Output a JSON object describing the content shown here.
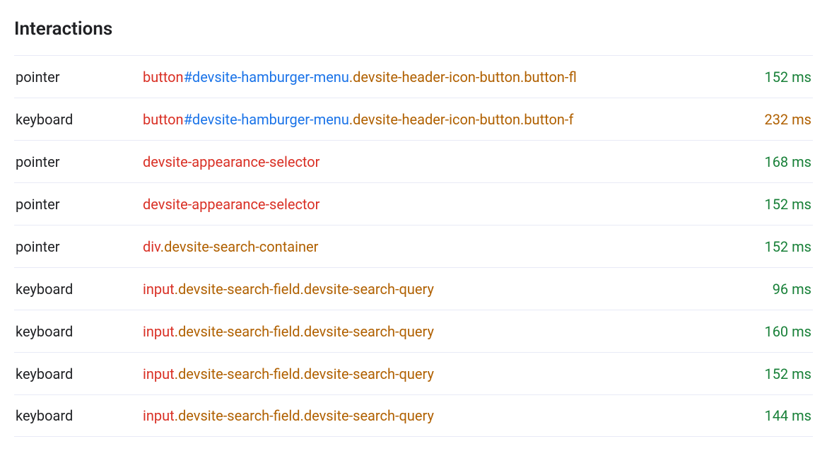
{
  "title": "Interactions",
  "colors": {
    "element": "#d93025",
    "id": "#1a73e8",
    "class": "#b06000",
    "timeGood": "#188038",
    "timeWarn": "#b06000"
  },
  "rows": [
    {
      "type": "pointer",
      "target": [
        {
          "kind": "el",
          "text": "button"
        },
        {
          "kind": "id",
          "text": "#devsite-hamburger-menu"
        },
        {
          "kind": "cls",
          "text": ".devsite-header-icon-button.button-fl"
        }
      ],
      "time": "152 ms",
      "timeLevel": "good"
    },
    {
      "type": "keyboard",
      "target": [
        {
          "kind": "el",
          "text": "button"
        },
        {
          "kind": "id",
          "text": "#devsite-hamburger-menu"
        },
        {
          "kind": "cls",
          "text": ".devsite-header-icon-button.button-f"
        }
      ],
      "time": "232 ms",
      "timeLevel": "warn"
    },
    {
      "type": "pointer",
      "target": [
        {
          "kind": "el",
          "text": "devsite-appearance-selector"
        }
      ],
      "time": "168 ms",
      "timeLevel": "good"
    },
    {
      "type": "pointer",
      "target": [
        {
          "kind": "el",
          "text": "devsite-appearance-selector"
        }
      ],
      "time": "152 ms",
      "timeLevel": "good"
    },
    {
      "type": "pointer",
      "target": [
        {
          "kind": "el",
          "text": "div"
        },
        {
          "kind": "cls",
          "text": ".devsite-search-container"
        }
      ],
      "time": "152 ms",
      "timeLevel": "good"
    },
    {
      "type": "keyboard",
      "target": [
        {
          "kind": "el",
          "text": "input"
        },
        {
          "kind": "cls",
          "text": ".devsite-search-field.devsite-search-query"
        }
      ],
      "time": "96 ms",
      "timeLevel": "good"
    },
    {
      "type": "keyboard",
      "target": [
        {
          "kind": "el",
          "text": "input"
        },
        {
          "kind": "cls",
          "text": ".devsite-search-field.devsite-search-query"
        }
      ],
      "time": "160 ms",
      "timeLevel": "good"
    },
    {
      "type": "keyboard",
      "target": [
        {
          "kind": "el",
          "text": "input"
        },
        {
          "kind": "cls",
          "text": ".devsite-search-field.devsite-search-query"
        }
      ],
      "time": "152 ms",
      "timeLevel": "good"
    },
    {
      "type": "keyboard",
      "target": [
        {
          "kind": "el",
          "text": "input"
        },
        {
          "kind": "cls",
          "text": ".devsite-search-field.devsite-search-query"
        }
      ],
      "time": "144 ms",
      "timeLevel": "good"
    }
  ]
}
